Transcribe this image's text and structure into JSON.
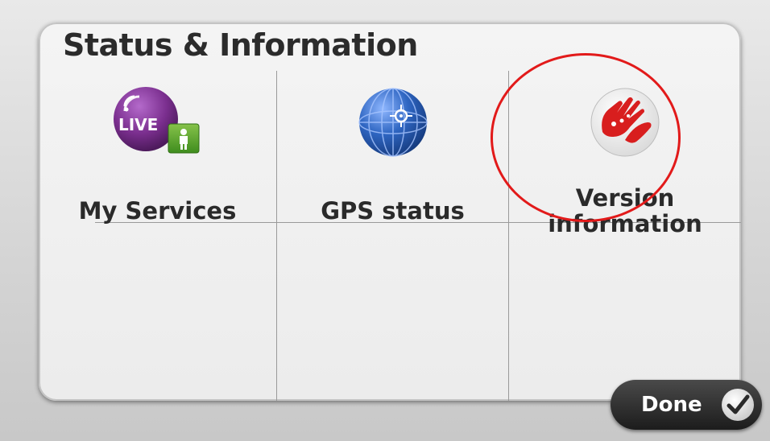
{
  "screen": {
    "title": "Status & Information"
  },
  "tiles": [
    {
      "label": "My Services",
      "icon": "live-services-icon",
      "icon_badge_text": "LIVE"
    },
    {
      "label": "GPS status",
      "icon": "gps-globe-icon"
    },
    {
      "label_line1": "Version",
      "label_line2": "information",
      "icon": "tomtom-hand-logo-icon",
      "highlighted": true
    }
  ],
  "footer": {
    "done_label": "Done",
    "done_icon": "checkmark-icon"
  },
  "colors": {
    "highlight_ring": "#e21a1a",
    "live_icon": "#7b2f8f",
    "gps_globe": "#2f66c2",
    "tomtom_red": "#d81e1e",
    "done_button": "#2a2a2a"
  }
}
